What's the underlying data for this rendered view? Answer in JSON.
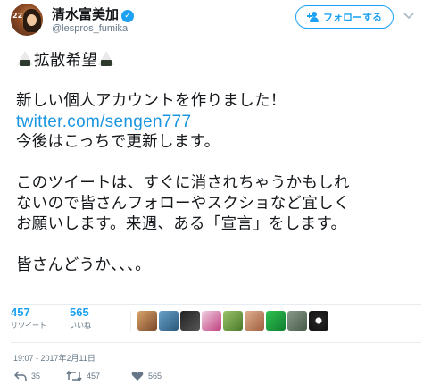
{
  "user": {
    "display_name": "清水富美加",
    "handle": "@lespros_fumika",
    "verified": true,
    "avatar_badge": "22"
  },
  "follow_button": {
    "label": "フォローする",
    "icon": "add-user-icon"
  },
  "menu": {
    "icon": "chevron-down-icon"
  },
  "tweet": {
    "line1": "拡散希望",
    "line2": "新しい個人アカウントを作りました！",
    "link": "twitter.com/sengen777",
    "line3": "今後はこっちで更新します。",
    "line4": "このツイートは、すぐに消されちゃうかもしれ",
    "line5": "ないので皆さんフォローやスクショなど宜しく",
    "line6": "お願いします。来週、ある「宣言」をします。",
    "line7": "皆さんどうか、、、。",
    "emoji": "onigiri-icon"
  },
  "stats": {
    "retweets": {
      "count": "457",
      "label": "リツイート"
    },
    "likes": {
      "count": "565",
      "label": "いいね"
    }
  },
  "likers_count_shown": 9,
  "timestamp": "19:07 - 2017年2月11日",
  "actions": {
    "reply": {
      "count": "35",
      "icon": "reply-icon"
    },
    "retweet": {
      "count": "457",
      "icon": "retweet-icon"
    },
    "like": {
      "count": "565",
      "icon": "heart-icon"
    }
  },
  "colors": {
    "accent": "#1da1f2",
    "link": "#1b95e0",
    "muted": "#657786",
    "divider": "#e6ecf0",
    "text": "#14171a"
  }
}
